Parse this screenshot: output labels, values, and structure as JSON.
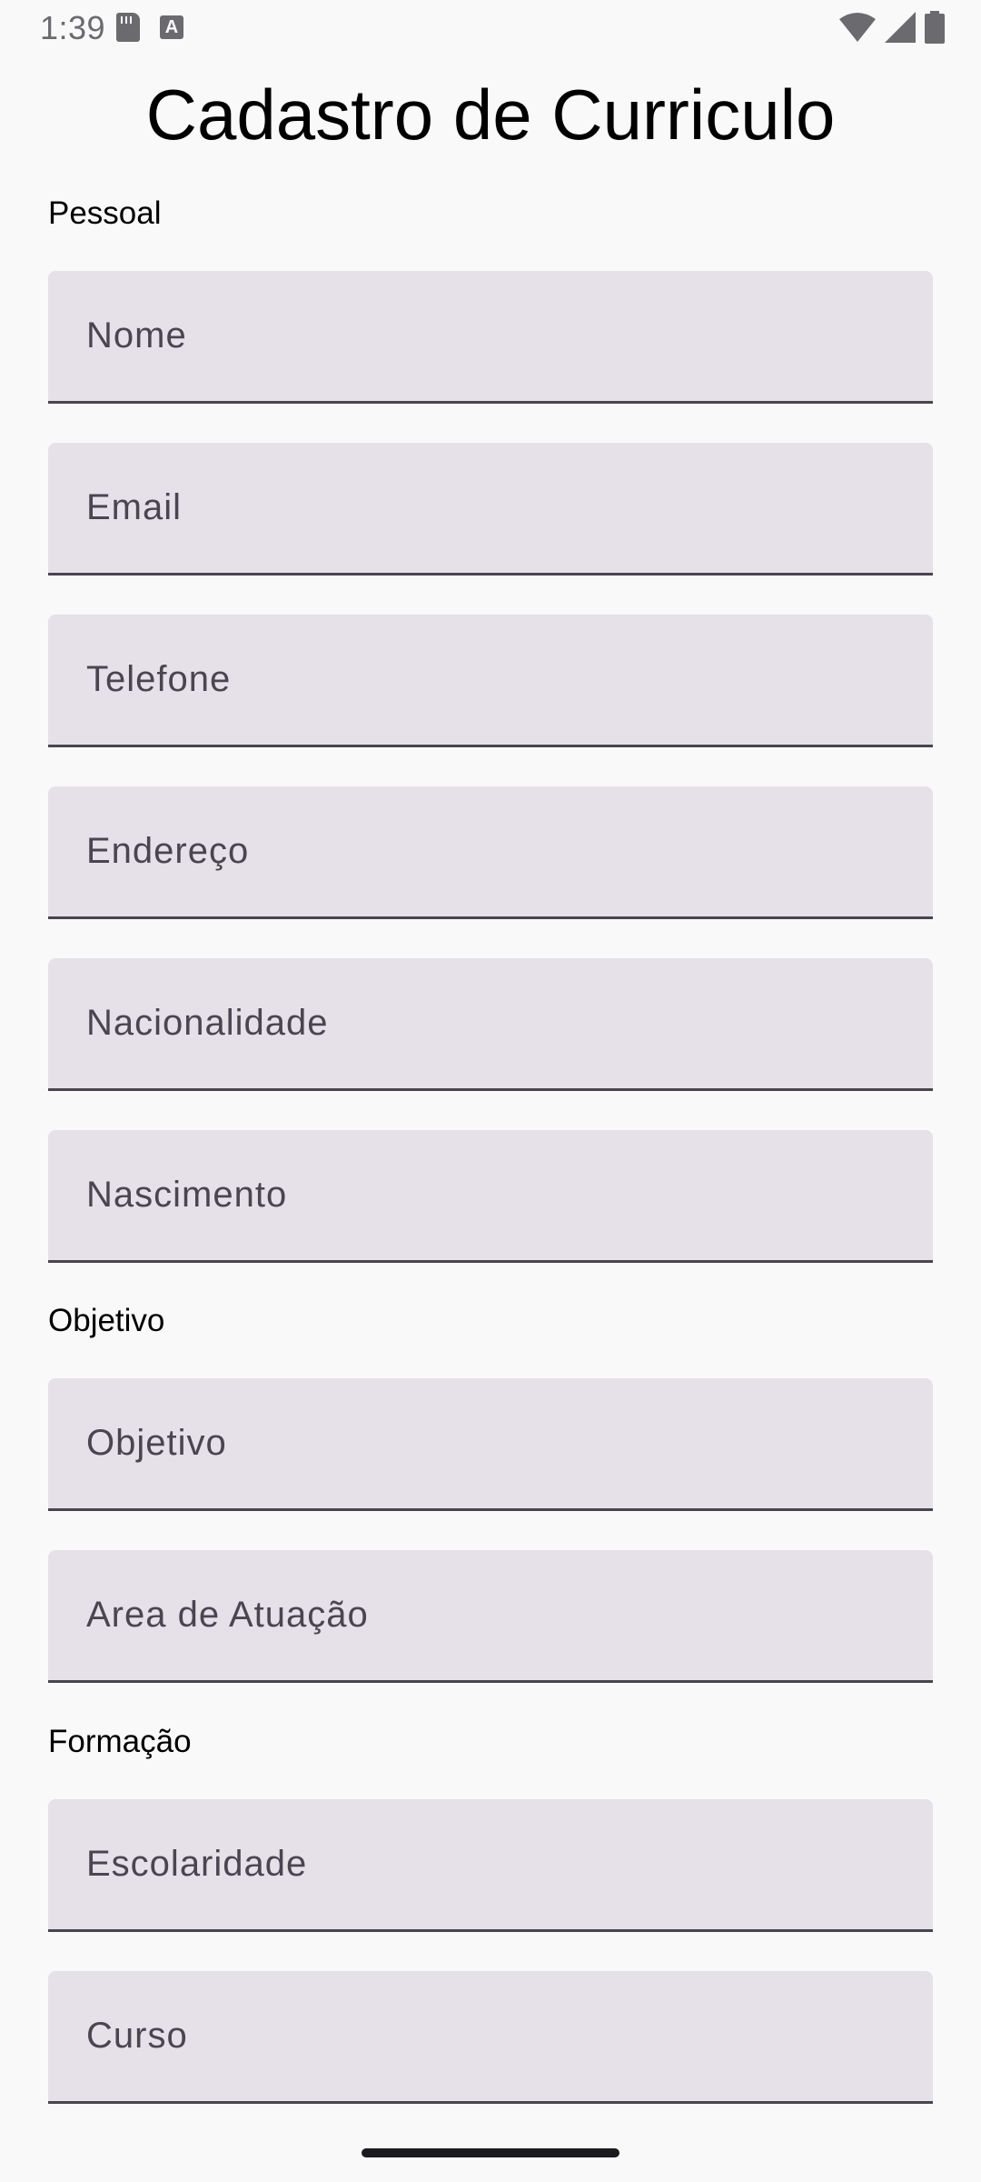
{
  "status_bar": {
    "time": "1:39",
    "left_icons": [
      "sd-card-icon",
      "a-keyboard-icon"
    ],
    "right_icons": [
      "wifi-icon",
      "cell-signal-icon",
      "battery-icon"
    ]
  },
  "title": "Cadastro de Curriculo",
  "sections": {
    "personal": "Pessoal",
    "objective": "Objetivo",
    "education": "Formação"
  },
  "fields": {
    "nome": {
      "placeholder": "Nome",
      "value": ""
    },
    "email": {
      "placeholder": "Email",
      "value": ""
    },
    "telefone": {
      "placeholder": "Telefone",
      "value": ""
    },
    "endereco": {
      "placeholder": "Endereço",
      "value": ""
    },
    "nacionalidade": {
      "placeholder": "Nacionalidade",
      "value": ""
    },
    "nascimento": {
      "placeholder": "Nascimento",
      "value": ""
    },
    "objetivo": {
      "placeholder": "Objetivo",
      "value": ""
    },
    "area_atuacao": {
      "placeholder": "Area de Atuação",
      "value": ""
    },
    "escolaridade": {
      "placeholder": "Escolaridade",
      "value": ""
    },
    "curso": {
      "placeholder": "Curso",
      "value": ""
    }
  },
  "colors": {
    "background": "#f9f9fa",
    "field_fill": "#e6e0e8",
    "field_underline": "#49454f",
    "placeholder": "#4a4650"
  }
}
